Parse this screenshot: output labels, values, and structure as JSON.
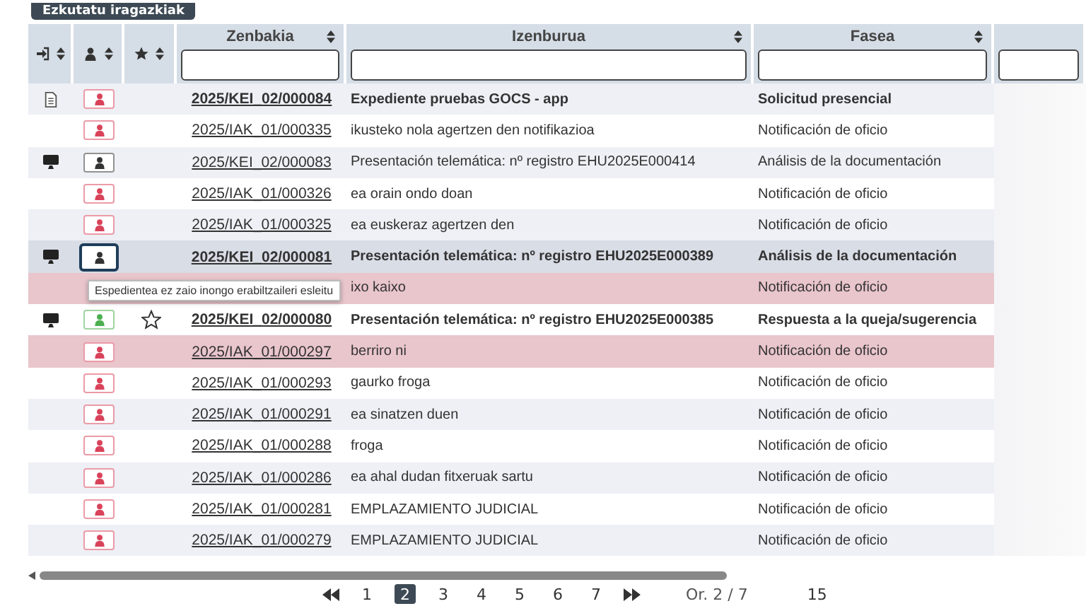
{
  "filter_button": {
    "label": "Ezkutatu iragazkiak"
  },
  "columns": [
    {
      "label": "Zenbakia"
    },
    {
      "label": "Izenburua"
    },
    {
      "label": "Fasea"
    }
  ],
  "rows": [
    {
      "kind": "document",
      "color": "#d9435a",
      "focused": false,
      "star_shown": false,
      "number": "2025/KEI_02/000084",
      "title": "Expediente pruebas GOCS - app",
      "phase": "Solicitud presencial",
      "unread": true,
      "highlighted": false,
      "hovered": false
    },
    {
      "kind": "plain",
      "color": "#d9435a",
      "focused": false,
      "star_shown": false,
      "number": "2025/IAK_01/000335",
      "title": "ikusteko nola agertzen den notifikazioa",
      "phase": "Notificación de oficio",
      "unread": false,
      "highlighted": false,
      "hovered": false
    },
    {
      "kind": "computer",
      "color": "#333333",
      "focused": false,
      "star_shown": false,
      "number": "2025/KEI_02/000083",
      "title": "Presentación telemática: nº registro EHU2025E000414",
      "phase": "Análisis de la documentación",
      "unread": false,
      "highlighted": false,
      "hovered": false
    },
    {
      "kind": "plain",
      "color": "#d9435a",
      "focused": false,
      "star_shown": false,
      "number": "2025/IAK_01/000326",
      "title": "ea orain ondo doan",
      "phase": "Notificación de oficio",
      "unread": false,
      "highlighted": false,
      "hovered": false
    },
    {
      "kind": "plain",
      "color": "#d9435a",
      "focused": false,
      "star_shown": false,
      "number": "2025/IAK_01/000325",
      "title": "ea euskeraz agertzen den",
      "phase": "Notificación de oficio",
      "unread": false,
      "highlighted": false,
      "hovered": false
    },
    {
      "kind": "computer",
      "color": "#333333",
      "focused": true,
      "star_shown": false,
      "number": "2025/KEI_02/000081",
      "title": "Presentación telemática: nº registro EHU2025E000389",
      "phase": "Análisis de la documentación",
      "unread": true,
      "highlighted": false,
      "hovered": true
    },
    {
      "kind": "plain",
      "star_shown": false,
      "title": "ixo kaixo",
      "phase": "Notificación de oficio",
      "unread": false,
      "highlighted": true,
      "hovered": false
    },
    {
      "kind": "computer",
      "color": "#4caf50",
      "focused": false,
      "star_shown": true,
      "number": "2025/KEI_02/000080",
      "title": "Presentación telemática: nº registro EHU2025E000385",
      "phase": "Respuesta a la queja/sugerencia",
      "unread": true,
      "highlighted": false,
      "hovered": false
    },
    {
      "kind": "plain",
      "color": "#d9435a",
      "focused": false,
      "star_shown": false,
      "number": "2025/IAK_01/000297",
      "title": "berriro ni",
      "phase": "Notificación de oficio",
      "unread": false,
      "highlighted": true,
      "hovered": false
    },
    {
      "kind": "plain",
      "color": "#d9435a",
      "focused": false,
      "star_shown": false,
      "number": "2025/IAK_01/000293",
      "title": "gaurko froga",
      "phase": "Notificación de oficio",
      "unread": false,
      "highlighted": false,
      "hovered": false
    },
    {
      "kind": "plain",
      "color": "#d9435a",
      "focused": false,
      "star_shown": false,
      "number": "2025/IAK_01/000291",
      "title": "ea sinatzen duen",
      "phase": "Notificación de oficio",
      "unread": false,
      "highlighted": false,
      "hovered": false
    },
    {
      "kind": "plain",
      "color": "#d9435a",
      "focused": false,
      "star_shown": false,
      "number": "2025/IAK_01/000288",
      "title": "froga",
      "phase": "Notificación de oficio",
      "unread": false,
      "highlighted": false,
      "hovered": false
    },
    {
      "kind": "plain",
      "color": "#d9435a",
      "focused": false,
      "star_shown": false,
      "number": "2025/IAK_01/000286",
      "title": "ea ahal dudan fitxeruak sartu",
      "phase": "Notificación de oficio",
      "unread": false,
      "highlighted": false,
      "hovered": false
    },
    {
      "kind": "plain",
      "color": "#d9435a",
      "focused": false,
      "star_shown": false,
      "number": "2025/IAK_01/000281",
      "title": "EMPLAZAMIENTO JUDICIAL",
      "phase": "Notificación de oficio",
      "unread": false,
      "highlighted": false,
      "hovered": false
    },
    {
      "kind": "plain",
      "color": "#d9435a",
      "focused": false,
      "star_shown": false,
      "number": "2025/IAK_01/000279",
      "title": "EMPLAZAMIENTO JUDICIAL",
      "phase": "Notificación de oficio",
      "unread": false,
      "highlighted": false,
      "hovered": false
    }
  ],
  "tooltip": {
    "text": "Espedientea ez zaio inongo erabiltzaileri esleitu"
  },
  "pagination": {
    "pages": [
      {
        "label": "1",
        "selected": false
      },
      {
        "label": "2",
        "selected": true
      },
      {
        "label": "3",
        "selected": false
      },
      {
        "label": "4",
        "selected": false
      },
      {
        "label": "5",
        "selected": false
      },
      {
        "label": "6",
        "selected": false
      },
      {
        "label": "7",
        "selected": false
      }
    ],
    "page_info": "Or. 2 / 7",
    "page_size": "15"
  }
}
